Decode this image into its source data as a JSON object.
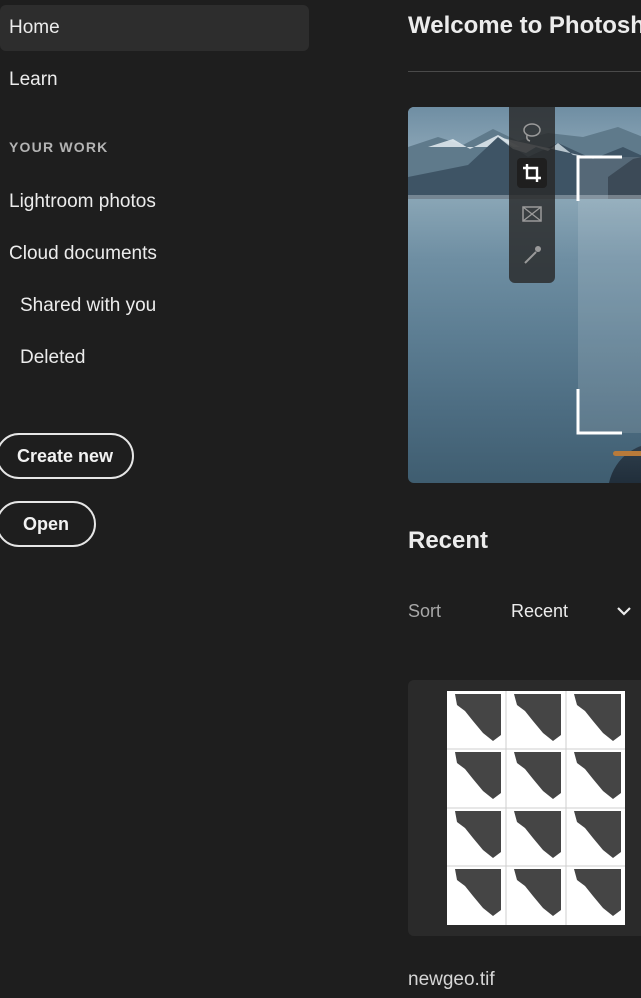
{
  "sidebar": {
    "nav": {
      "home": "Home",
      "learn": "Learn"
    },
    "section_label": "YOUR WORK",
    "work": {
      "lightroom": "Lightroom photos",
      "cloud": "Cloud documents",
      "shared": "Shared with you",
      "deleted": "Deleted"
    },
    "buttons": {
      "create_new": "Create new",
      "open": "Open"
    }
  },
  "main": {
    "welcome_title": "Welcome to Photoshop",
    "hero": {
      "tools": [
        "lasso-icon",
        "crop-icon",
        "frame-icon",
        "eyedropper-icon"
      ],
      "active_tool": "crop-icon"
    },
    "recent": {
      "title": "Recent",
      "sort_label": "Sort",
      "sort_value": "Recent",
      "files": [
        {
          "name": "newgeo.tif"
        }
      ]
    }
  },
  "colors": {
    "background": "#1e1e1e",
    "active_nav": "#2d2d2d",
    "card": "#2a2a2a",
    "text": "#ececec",
    "muted_text": "#a8a8a8"
  }
}
